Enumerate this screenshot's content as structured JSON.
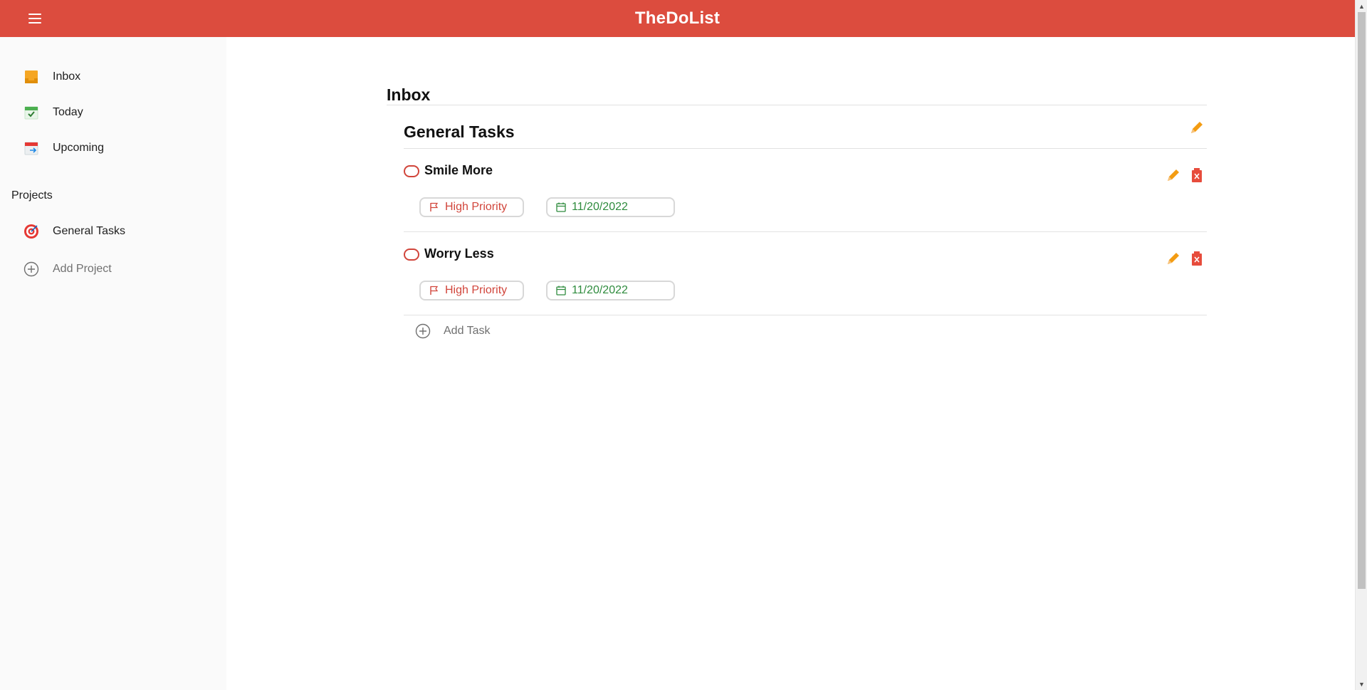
{
  "app": {
    "title": "TheDoList"
  },
  "sidebar": {
    "items": [
      {
        "label": "Inbox",
        "icon": "inbox-icon"
      },
      {
        "label": "Today",
        "icon": "calendar-check-icon"
      },
      {
        "label": "Upcoming",
        "icon": "calendar-arrow-icon"
      }
    ],
    "projects_title": "Projects",
    "projects": [
      {
        "label": "General Tasks",
        "icon": "target-icon"
      }
    ],
    "add_project_label": "Add Project"
  },
  "main": {
    "page_title": "Inbox",
    "project_title": "General Tasks",
    "tasks": [
      {
        "name": "Smile More",
        "priority": "High Priority",
        "date": "11/20/2022"
      },
      {
        "name": "Worry Less",
        "priority": "High Priority",
        "date": "11/20/2022"
      }
    ],
    "add_task_label": "Add Task"
  },
  "colors": {
    "brand": "#dc4c3e",
    "priority": "#d1453b",
    "date": "#2e8b3d",
    "edit": "#f39c12",
    "delete": "#e74c3c"
  }
}
